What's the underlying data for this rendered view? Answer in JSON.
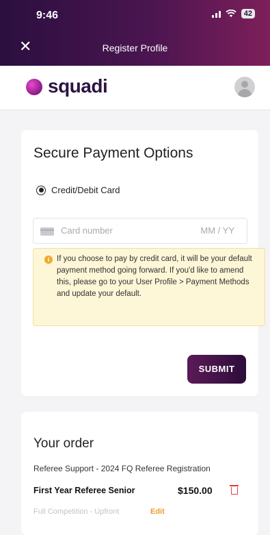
{
  "status_bar": {
    "time": "9:46",
    "battery": "42"
  },
  "header": {
    "title": "Register Profile",
    "close_label": "✕"
  },
  "brand": {
    "name": "squadi"
  },
  "payment": {
    "title": "Secure Payment Options",
    "option_label": "Credit/Debit Card",
    "card_number_placeholder": "Card number",
    "expiry_placeholder": "MM / YY",
    "notice": "If you choose to pay by credit card, it will be your default payment method going forward. If you'd like to amend this, please go to your User Profile > Payment Methods and update your default.",
    "submit_label": "SUBMIT"
  },
  "order": {
    "title": "Your order",
    "description": "Referee Support - 2024 FQ Referee Registration",
    "item_name": "First Year Referee Senior",
    "price": "$150.00",
    "payment_type": "Full Competition - Upfront",
    "edit_label": "Edit"
  },
  "colors": {
    "header_gradient_start": "#2b0f3f",
    "header_gradient_end": "#7d1f5a",
    "accent_orange": "#f29a2e",
    "delete_red": "#e23b3b",
    "notice_bg": "#fdf6d7"
  },
  "icons": {
    "close": "close-icon",
    "signal": "cellular-signal-icon",
    "wifi": "wifi-icon",
    "battery": "battery-icon",
    "avatar": "user-avatar-icon",
    "card": "credit-card-icon",
    "info": "info-icon",
    "delete": "trash-icon"
  }
}
